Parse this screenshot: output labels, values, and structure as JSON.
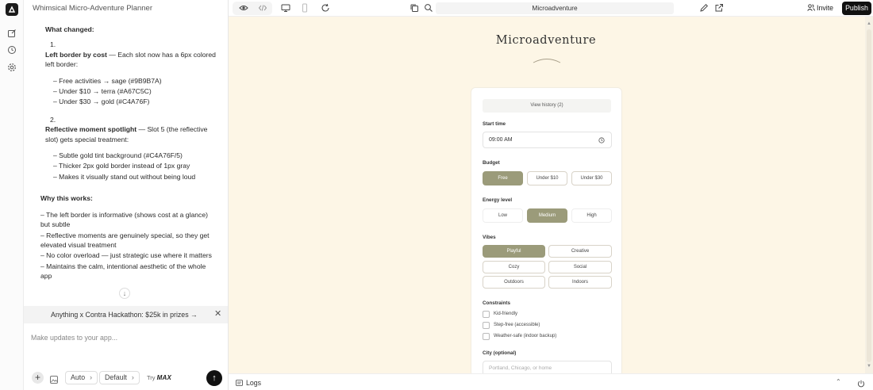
{
  "chat": {
    "title": "Whimsical Micro-Adventure Planner",
    "message": {
      "heading_changed": "What changed:",
      "item1_num": "1.",
      "item1_title": "Left border by cost",
      "item1_rest": " — Each slot now has a 6px colored left border:",
      "item1_subs": [
        "– Free activities → sage (#9B9B7A)",
        "– Under $10 → terra (#A67C5C)",
        "– Under $30 → gold (#C4A76F)"
      ],
      "item2_num": "2.",
      "item2_title": "Reflective moment spotlight",
      "item2_rest": " — Slot 5 (the reflective slot) gets special treatment:",
      "item2_subs": [
        "– Subtle gold tint background (#C4A76F/5)",
        "– Thicker 2px gold border instead of 1px gray",
        "– Makes it visually stand out without being loud"
      ],
      "heading_why": "Why this works:",
      "why_items": [
        "– The left border is informative (shows cost at a glance) but subtle",
        "– Reflective moments are genuinely special, so they get elevated visual treatment",
        "– No color overload — just strategic use where it matters",
        "– Maintains the calm, intentional aesthetic of the whole app"
      ]
    },
    "banner": "Anything x Contra Hackathon: $25k in prizes →",
    "composer_placeholder": "Make updates to your app...",
    "mode_label": "Auto",
    "model_label": "Default",
    "try_prefix": "Try",
    "try_brand": "MAX"
  },
  "topbar": {
    "url": "Microadventure",
    "invite_label": "Invite",
    "publish_label": "Publish"
  },
  "preview": {
    "app_title": "Microadventure",
    "history_button": "View history (2)",
    "start_time_label": "Start time",
    "start_time_value": "09:00 AM",
    "budget_label": "Budget",
    "budget_options": [
      "Free",
      "Under $10",
      "Under $30"
    ],
    "budget_selected": "Free",
    "energy_label": "Energy level",
    "energy_options": [
      "Low",
      "Medium",
      "High"
    ],
    "energy_selected": "Medium",
    "vibes_label": "Vibes",
    "vibes_options": [
      "Playful",
      "Creative",
      "Cozy",
      "Social",
      "Outdoors",
      "Indoors"
    ],
    "vibes_selected": "Playful",
    "constraints_label": "Constraints",
    "constraints": [
      "Kid-friendly",
      "Step-free (accessible)",
      "Weather-safe (indoor backup)"
    ],
    "city_label": "City (optional)",
    "city_placeholder": "Portland, Chicago, or home"
  },
  "bottombar": {
    "logs_label": "Logs"
  },
  "colors": {
    "sage": "#9B9B7A",
    "preview_bg": "#FDF6E6",
    "publish_bg": "#111111"
  },
  "icons": [
    "app-logo-icon",
    "edit-icon",
    "history-icon",
    "settings-icon",
    "eye-icon",
    "code-icon",
    "desktop-icon",
    "mobile-icon",
    "refresh-icon",
    "copy-icon",
    "search-icon",
    "pencil-icon",
    "external-link-icon",
    "users-icon",
    "clock-icon",
    "arrow-down-icon",
    "close-icon",
    "plus-icon",
    "image-icon",
    "arrow-up-icon",
    "logs-icon",
    "chevron-up-icon",
    "power-icon"
  ]
}
